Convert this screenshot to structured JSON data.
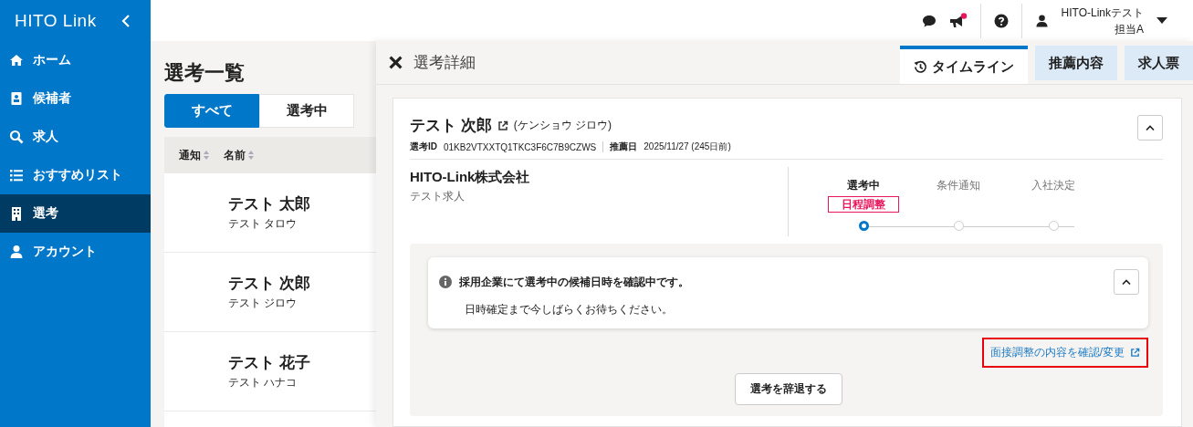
{
  "sidebar": {
    "logo": "HITO Link",
    "items": [
      {
        "label": "ホーム",
        "selected": false
      },
      {
        "label": "候補者",
        "selected": false
      },
      {
        "label": "求人",
        "selected": false
      },
      {
        "label": "おすすめリスト",
        "selected": false
      },
      {
        "label": "選考",
        "selected": true
      },
      {
        "label": "アカウント",
        "selected": false
      }
    ]
  },
  "topbar": {
    "announcement_unread": true,
    "user": {
      "name": "HITO-Linkテスト",
      "role": "担当A"
    }
  },
  "list_panel": {
    "title": "選考一覧",
    "tabs": [
      {
        "label": "すべて",
        "selected": true
      },
      {
        "label": "選考中",
        "selected": false
      }
    ],
    "columns": [
      "通知",
      "名前"
    ],
    "rows": [
      {
        "name": "テスト 太郎",
        "kana": "テスト タロウ"
      },
      {
        "name": "テスト 次郎",
        "kana": "テスト ジロウ"
      },
      {
        "name": "テスト 花子",
        "kana": "テスト ハナコ"
      }
    ]
  },
  "detail": {
    "title": "選考詳細",
    "tabs": [
      {
        "label": "タイムライン",
        "selected": true
      },
      {
        "label": "推薦内容",
        "selected": false
      },
      {
        "label": "求人票",
        "selected": false
      }
    ],
    "candidate": {
      "name": "テスト 次郎",
      "kana": "(ケンショウ ジロウ)",
      "id_label": "選考ID",
      "id": "01KB2VTXXTQ1TKC3F6C7B9CZWS",
      "date_label": "推薦日",
      "date": "2025/11/27 (245日前)"
    },
    "company": "HITO-Link株式会社",
    "job": "テスト求人",
    "steps": [
      {
        "label": "選考中",
        "selected": true,
        "status": "日程調整"
      },
      {
        "label": "条件通知",
        "selected": false
      },
      {
        "label": "入社決定",
        "selected": false
      }
    ],
    "notice": {
      "title": "採用企業にて選考中の候補日時を確認中です。",
      "body": "日時確定まで今しばらくお待ちください。"
    },
    "link": {
      "label": "面接調整の内容を確認/変更",
      "highlighted": true
    },
    "button": "選考を辞退する"
  }
}
